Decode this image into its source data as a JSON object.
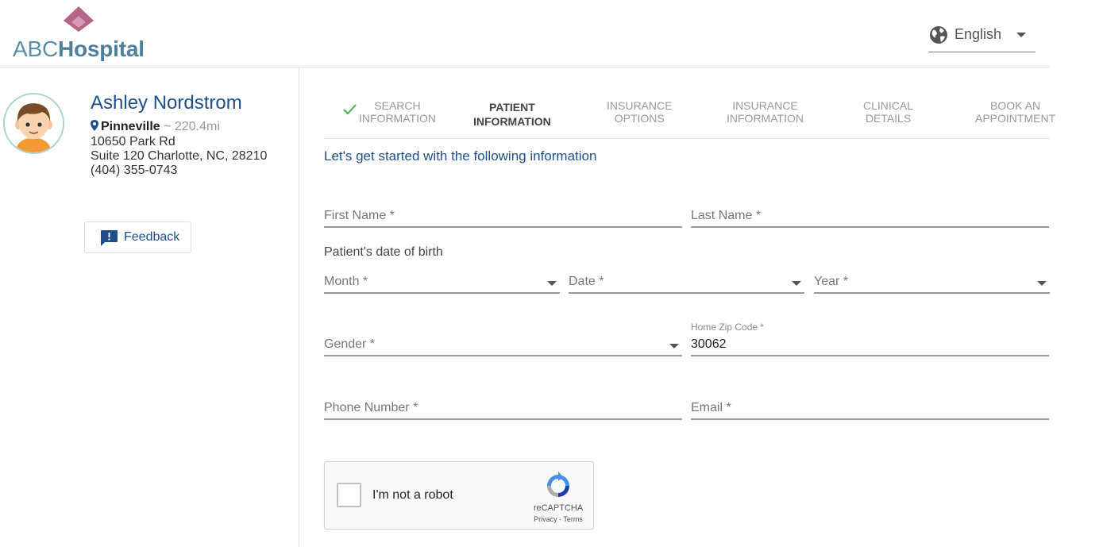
{
  "brand": {
    "logo_part1": "ABC",
    "logo_part2": "Hospital",
    "primary_color": "#1d4f8f",
    "logo_color": "#5b8fa8",
    "mark_color": "#b5648a"
  },
  "language": {
    "selected": "English",
    "icon": "globe-icon"
  },
  "doctor": {
    "name": "Ashley Nordstrom",
    "city": "Pinneville",
    "distance": "~ 220.4mi",
    "address1": "10650 Park Rd",
    "address2": "Suite 120 Charlotte, NC, 28210",
    "phone": "(404) 355-0743"
  },
  "feedback": {
    "label": "Feedback",
    "icon": "feedback-icon"
  },
  "steps": [
    {
      "line1": "SEARCH",
      "line2": "INFORMATION",
      "state": "done"
    },
    {
      "line1": "PATIENT",
      "line2": "INFORMATION",
      "state": "active"
    },
    {
      "line1": "INSURANCE",
      "line2": "OPTIONS",
      "state": "pending"
    },
    {
      "line1": "INSURANCE",
      "line2": "INFORMATION",
      "state": "pending"
    },
    {
      "line1": "CLINICAL",
      "line2": "DETAILS",
      "state": "pending"
    },
    {
      "line1": "BOOK AN",
      "line2": "APPOINTMENT",
      "state": "pending"
    }
  ],
  "form": {
    "intro": "Let's get started with the following information",
    "first_name": {
      "placeholder": "First Name *",
      "value": ""
    },
    "last_name": {
      "placeholder": "Last Name *",
      "value": ""
    },
    "dob_label": "Patient's date of birth",
    "month": {
      "placeholder": "Month *"
    },
    "date": {
      "placeholder": "Date *"
    },
    "year": {
      "placeholder": "Year *"
    },
    "gender": {
      "placeholder": "Gender *"
    },
    "zip": {
      "label": "Home Zip Code *",
      "value": "30062"
    },
    "phone": {
      "placeholder": "Phone Number *",
      "value": ""
    },
    "email": {
      "placeholder": "Email *",
      "value": ""
    }
  },
  "captcha": {
    "label": "I'm not a robot",
    "brand": "reCAPTCHA",
    "terms": "Privacy - Terms"
  }
}
